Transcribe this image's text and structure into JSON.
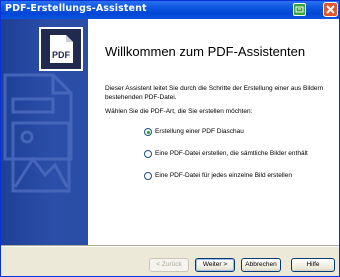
{
  "window": {
    "title": "PDF-Erstellungs-Assistent"
  },
  "icons": {
    "app": "green-app-icon",
    "close": "close-icon",
    "logo": "pdf-document-icon",
    "watermark": "pdf-image-watermark-icon"
  },
  "logo": {
    "text": "PDF"
  },
  "content": {
    "heading": "Willkommen zum PDF-Assistenten",
    "description": "Dieser Assistent leitet Sie durch die Schritte der Erstellung einer aus Bildern bestehenden PDF-Datei.",
    "prompt": "Wählen Sie die PDF-Art, die Sie erstellen möchten:"
  },
  "options": [
    {
      "label": "Erstellung einer PDF Diaschau",
      "selected": true
    },
    {
      "label": "Eine PDF-Datei erstellen, die sämtliche Bilder enthält",
      "selected": false
    },
    {
      "label": "Eine PDF-Datei für jedes einzelne Bild erstellen",
      "selected": false
    }
  ],
  "buttons": {
    "back": "< Zurück",
    "next": "Weiter >",
    "cancel": "Abbrechen",
    "help": "Hilfe"
  },
  "colors": {
    "titlebar": "#0a55df",
    "sidebar": "#2b4fa8",
    "radio_selected": "#21a121"
  }
}
